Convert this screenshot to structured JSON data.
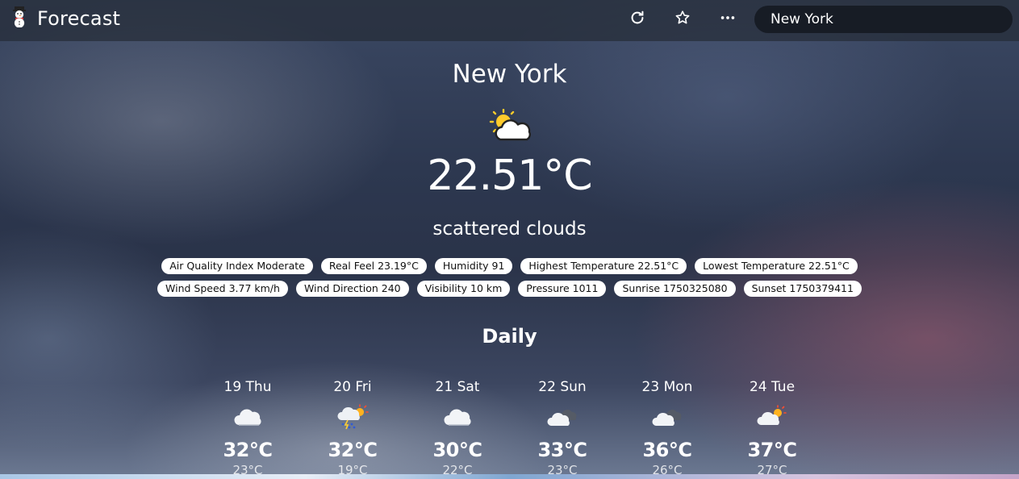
{
  "app": {
    "title": "Forecast",
    "logo_icon": "snowman-icon"
  },
  "toolbar": {
    "refresh_icon": "refresh-icon",
    "favorite_icon": "star-icon",
    "more_icon": "more-dots-icon"
  },
  "search": {
    "value": "New York"
  },
  "current": {
    "city": "New York",
    "icon": "sun-behind-cloud-icon",
    "temperature": "22.51°C",
    "description": "scattered clouds"
  },
  "details_row1": [
    "Air Quality Index Moderate",
    "Real Feel 23.19°C",
    "Humidity 91",
    "Highest Temperature 22.51°C",
    "Lowest Temperature 22.51°C"
  ],
  "details_row2": [
    "Wind Speed 3.77 km/h",
    "Wind Direction 240",
    "Visibility 10 km",
    "Pressure 1011",
    "Sunrise 1750325080",
    "Sunset 1750379411"
  ],
  "daily": {
    "title": "Daily",
    "days": [
      {
        "name": "19 Thu",
        "icon": "cloud-icon",
        "high": "32°C",
        "low": "23°C"
      },
      {
        "name": "20 Fri",
        "icon": "thunderstorm-sun-icon",
        "high": "32°C",
        "low": "19°C"
      },
      {
        "name": "21 Sat",
        "icon": "cloud-icon",
        "high": "30°C",
        "low": "22°C"
      },
      {
        "name": "22 Sun",
        "icon": "dark-clouds-icon",
        "high": "33°C",
        "low": "23°C"
      },
      {
        "name": "23 Mon",
        "icon": "dark-clouds-icon",
        "high": "36°C",
        "low": "26°C"
      },
      {
        "name": "24 Tue",
        "icon": "sun-behind-cloud-icon",
        "high": "37°C",
        "low": "27°C"
      }
    ]
  }
}
